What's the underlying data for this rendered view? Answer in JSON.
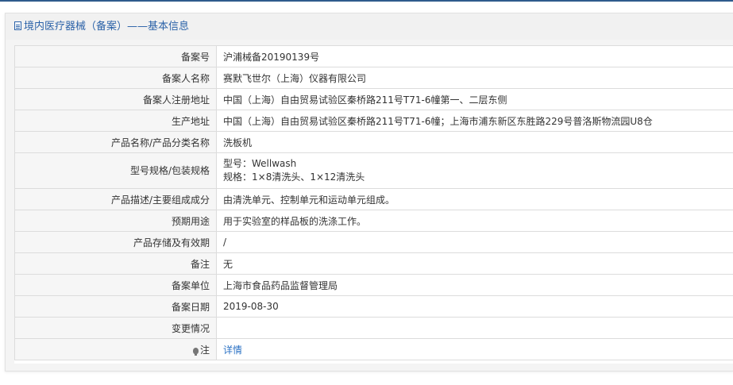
{
  "header": {
    "title": "境内医疗器械（备案）——基本信息"
  },
  "rows": [
    {
      "label": "备案号",
      "value": "沪浦械备20190139号"
    },
    {
      "label": "备案人名称",
      "value": "赛默飞世尔（上海）仪器有限公司"
    },
    {
      "label": "备案人注册地址",
      "value": "中国（上海）自由贸易试验区秦桥路211号T71-6幢第一、二层东侧"
    },
    {
      "label": "生产地址",
      "value": "中国（上海）自由贸易试验区秦桥路211号T71-6幢；上海市浦东新区东胜路229号普洛斯物流园U8仓"
    },
    {
      "label": "产品名称/产品分类名称",
      "value": "洗板机"
    },
    {
      "label": "型号规格/包装规格",
      "value_line1": "型号：Wellwash",
      "value_line2": "规格：1×8清洗头、1×12清洗头"
    },
    {
      "label": "产品描述/主要组成成分",
      "value": "由清洗单元、控制单元和运动单元组成。"
    },
    {
      "label": "预期用途",
      "value": "用于实验室的样品板的洗涤工作。"
    },
    {
      "label": "产品存储及有效期",
      "value": "/"
    },
    {
      "label": "备注",
      "value": "无"
    },
    {
      "label": "备案单位",
      "value": "上海市食品药品监督管理局"
    },
    {
      "label": "备案日期",
      "value": "2019-08-30"
    },
    {
      "label": "变更情况",
      "value": ""
    },
    {
      "label": "注",
      "value": "详情"
    }
  ],
  "icons": {
    "header": "document-icon",
    "note": "lightbulb-icon"
  },
  "colors": {
    "accent": "#2b62a8",
    "link": "#2b72c4"
  }
}
